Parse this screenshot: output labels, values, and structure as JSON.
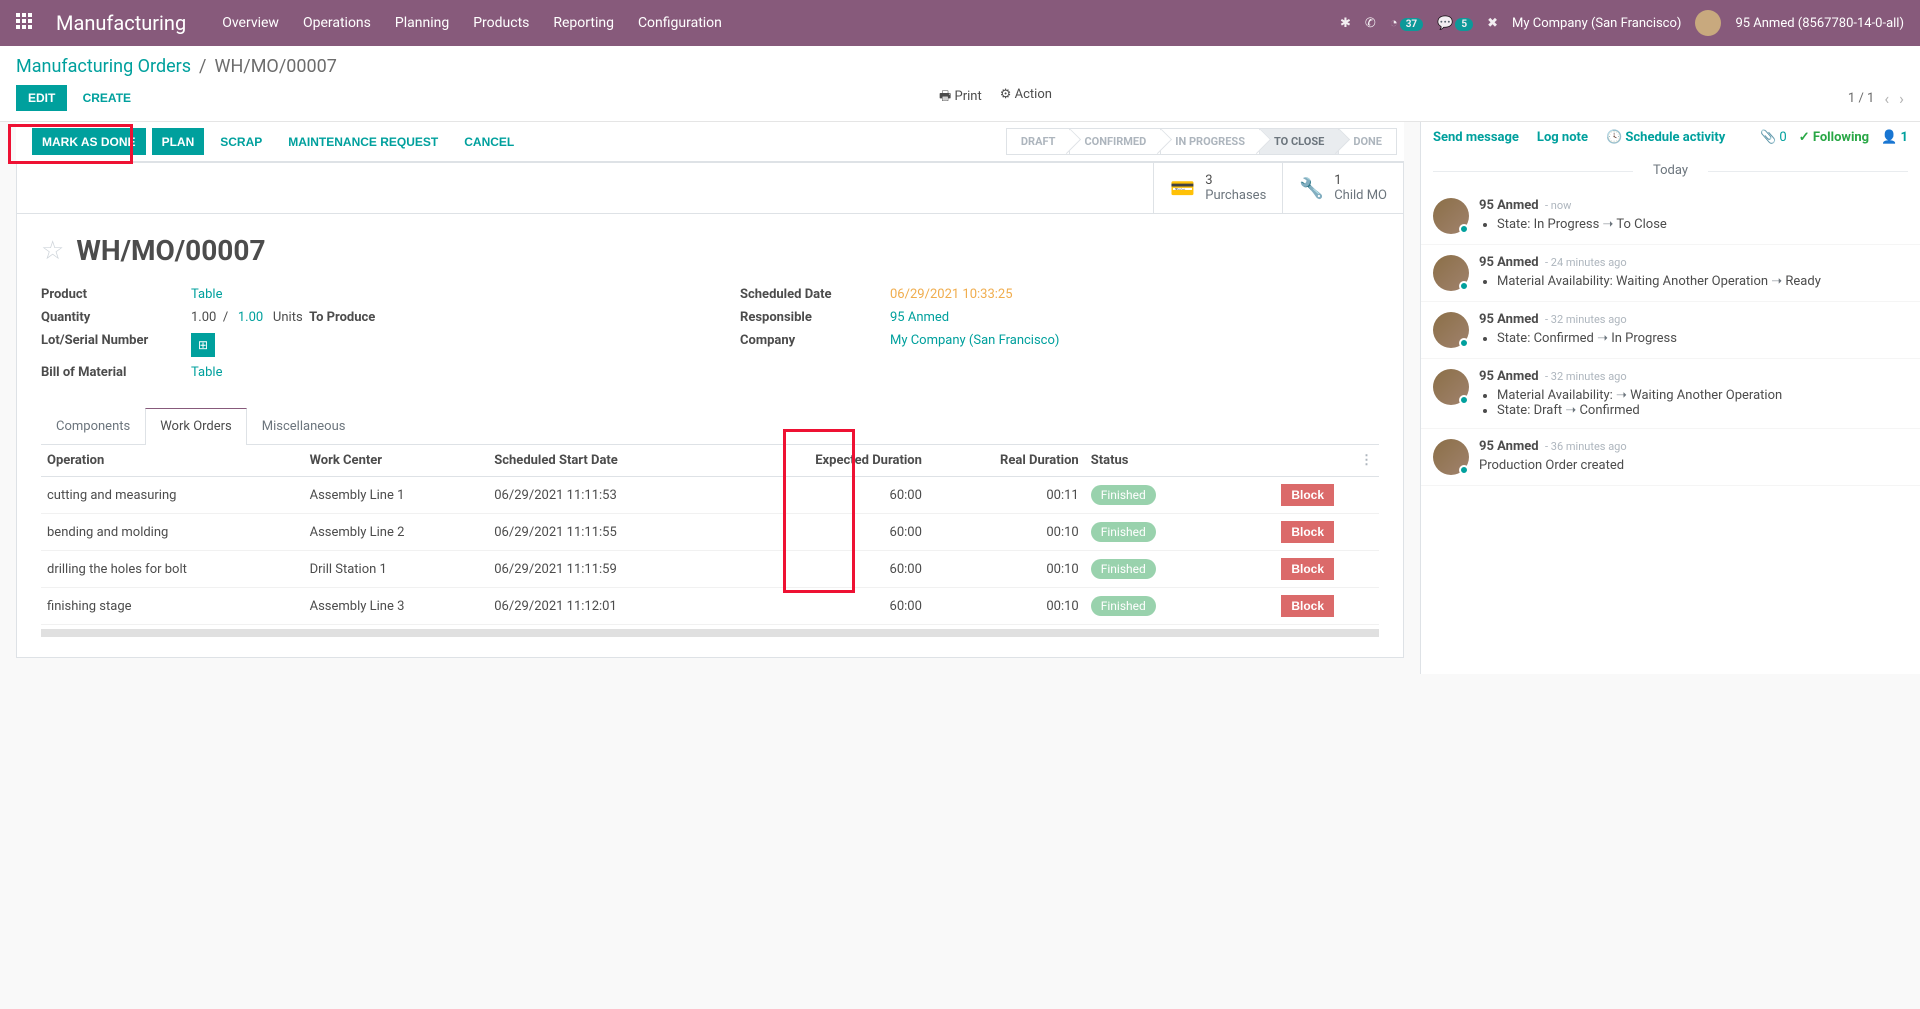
{
  "topnav": {
    "app": "Manufacturing",
    "menu": [
      "Overview",
      "Operations",
      "Planning",
      "Products",
      "Reporting",
      "Configuration"
    ],
    "timer_badge": "37",
    "msg_badge": "5",
    "company": "My Company (San Francisco)",
    "user": "95 Anmed (8567780-14-0-all)"
  },
  "breadcrumb": {
    "root": "Manufacturing Orders",
    "current": "WH/MO/00007"
  },
  "buttons": {
    "edit": "EDIT",
    "create": "CREATE",
    "print": "Print",
    "action": "Action"
  },
  "pager": {
    "text": "1 / 1"
  },
  "actions": {
    "mark_done": "MARK AS DONE",
    "plan": "PLAN",
    "scrap": "SCRAP",
    "maint": "MAINTENANCE REQUEST",
    "cancel": "CANCEL"
  },
  "status_steps": [
    "DRAFT",
    "CONFIRMED",
    "IN PROGRESS",
    "TO CLOSE",
    "DONE"
  ],
  "status_current": 3,
  "stat_buttons": [
    {
      "icon": "card",
      "num": "3",
      "label": "Purchases"
    },
    {
      "icon": "wrench",
      "num": "1",
      "label": "Child MO"
    }
  ],
  "record": {
    "title": "WH/MO/00007",
    "left": {
      "product_lbl": "Product",
      "product": "Table",
      "qty_lbl": "Quantity",
      "qty1": "1.00",
      "qty_sep": "/",
      "qty2": "1.00",
      "uom": "Units",
      "to_produce": "To Produce",
      "lot_lbl": "Lot/Serial Number",
      "bom_lbl": "Bill of Material",
      "bom": "Table"
    },
    "right": {
      "sched_lbl": "Scheduled Date",
      "sched": "06/29/2021 10:33:25",
      "resp_lbl": "Responsible",
      "resp": "95 Anmed",
      "comp_lbl": "Company",
      "comp": "My Company (San Francisco)"
    }
  },
  "tabs": [
    "Components",
    "Work Orders",
    "Miscellaneous"
  ],
  "active_tab": 1,
  "grid": {
    "headers": [
      "Operation",
      "Work Center",
      "Scheduled Start Date",
      "Expected Duration",
      "Real Duration",
      "Status",
      "",
      ""
    ],
    "rows": [
      {
        "op": "cutting and measuring",
        "wc": "Assembly Line 1",
        "start": "06/29/2021 11:11:53",
        "exp": "60:00",
        "real": "00:11",
        "status": "Finished",
        "block": "Block"
      },
      {
        "op": "bending and molding",
        "wc": "Assembly Line 2",
        "start": "06/29/2021 11:11:55",
        "exp": "60:00",
        "real": "00:10",
        "status": "Finished",
        "block": "Block"
      },
      {
        "op": "drilling the holes for bolt",
        "wc": "Drill Station 1",
        "start": "06/29/2021 11:11:59",
        "exp": "60:00",
        "real": "00:10",
        "status": "Finished",
        "block": "Block"
      },
      {
        "op": "finishing stage",
        "wc": "Assembly Line 3",
        "start": "06/29/2021 11:12:01",
        "exp": "60:00",
        "real": "00:10",
        "status": "Finished",
        "block": "Block"
      }
    ]
  },
  "chatter": {
    "send": "Send message",
    "log": "Log note",
    "schedule": "Schedule activity",
    "attach_count": "0",
    "following": "Following",
    "followers": "1",
    "today": "Today",
    "messages": [
      {
        "author": "95 Anmed",
        "time": "- now",
        "items": [
          {
            "label": "State:",
            "from": "In Progress",
            "to": "To Close"
          }
        ]
      },
      {
        "author": "95 Anmed",
        "time": "- 24 minutes ago",
        "items": [
          {
            "label": "Material Availability:",
            "from": "Waiting Another Operation",
            "to": "Ready"
          }
        ]
      },
      {
        "author": "95 Anmed",
        "time": "- 32 minutes ago",
        "items": [
          {
            "label": "State:",
            "from": "Confirmed",
            "to": "In Progress"
          }
        ]
      },
      {
        "author": "95 Anmed",
        "time": "- 32 minutes ago",
        "items": [
          {
            "label": "Material Availability:",
            "from": "",
            "to": "Waiting Another Operation"
          },
          {
            "label": "State:",
            "from": "Draft",
            "to": "Confirmed"
          }
        ]
      },
      {
        "author": "95 Anmed",
        "time": "- 36 minutes ago",
        "text": "Production Order created"
      }
    ]
  }
}
